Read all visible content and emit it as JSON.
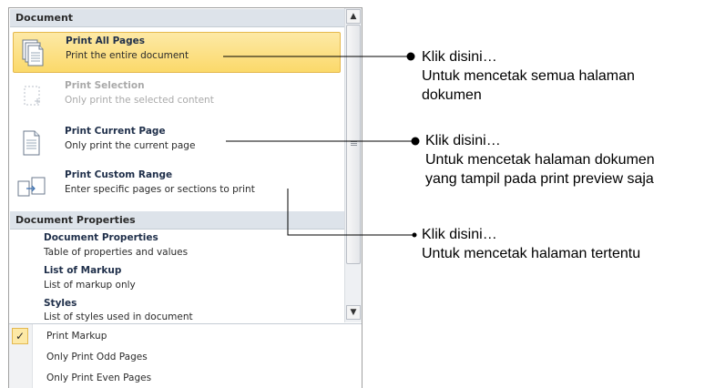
{
  "menu": {
    "document_section": "Document",
    "items": [
      {
        "title": "Print All Pages",
        "desc": "Print the entire document",
        "icon": "all-pages-icon"
      },
      {
        "title": "Print Selection",
        "desc": "Only print the selected content",
        "icon": "selection-icon"
      },
      {
        "title": "Print Current Page",
        "desc": "Only print the current page",
        "icon": "current-page-icon"
      },
      {
        "title": "Print Custom Range",
        "desc": "Enter specific pages or sections to print",
        "icon": "custom-range-icon"
      }
    ],
    "properties_section": "Document Properties",
    "properties": [
      {
        "title": "Document Properties",
        "desc": "Table of properties and values"
      },
      {
        "title": "List of Markup",
        "desc": "List of markup only"
      },
      {
        "title": "Styles",
        "desc": "List of styles used in document"
      }
    ],
    "options": [
      {
        "label": "Print Markup",
        "checked": true
      },
      {
        "label": "Only Print Odd Pages",
        "checked": false
      },
      {
        "label": "Only Print Even Pages",
        "checked": false
      }
    ],
    "check_glyph": "✓",
    "scroll_up_glyph": "▲",
    "scroll_down_glyph": "▼"
  },
  "annotations": [
    {
      "lines": [
        "Klik disini…",
        "Untuk mencetak semua halaman",
        "dokumen"
      ]
    },
    {
      "lines": [
        "Klik disini…",
        "Untuk mencetak halaman dokumen",
        "yang tampil pada print preview saja"
      ]
    },
    {
      "lines": [
        "Klik disini…",
        "Untuk mencetak halaman tertentu"
      ]
    }
  ],
  "colors": {
    "highlight_fill": "#fbd96a",
    "highlight_border": "#e5b84c",
    "section_header_bg": "#dde3ea",
    "disabled_text": "#a9a9a9"
  }
}
